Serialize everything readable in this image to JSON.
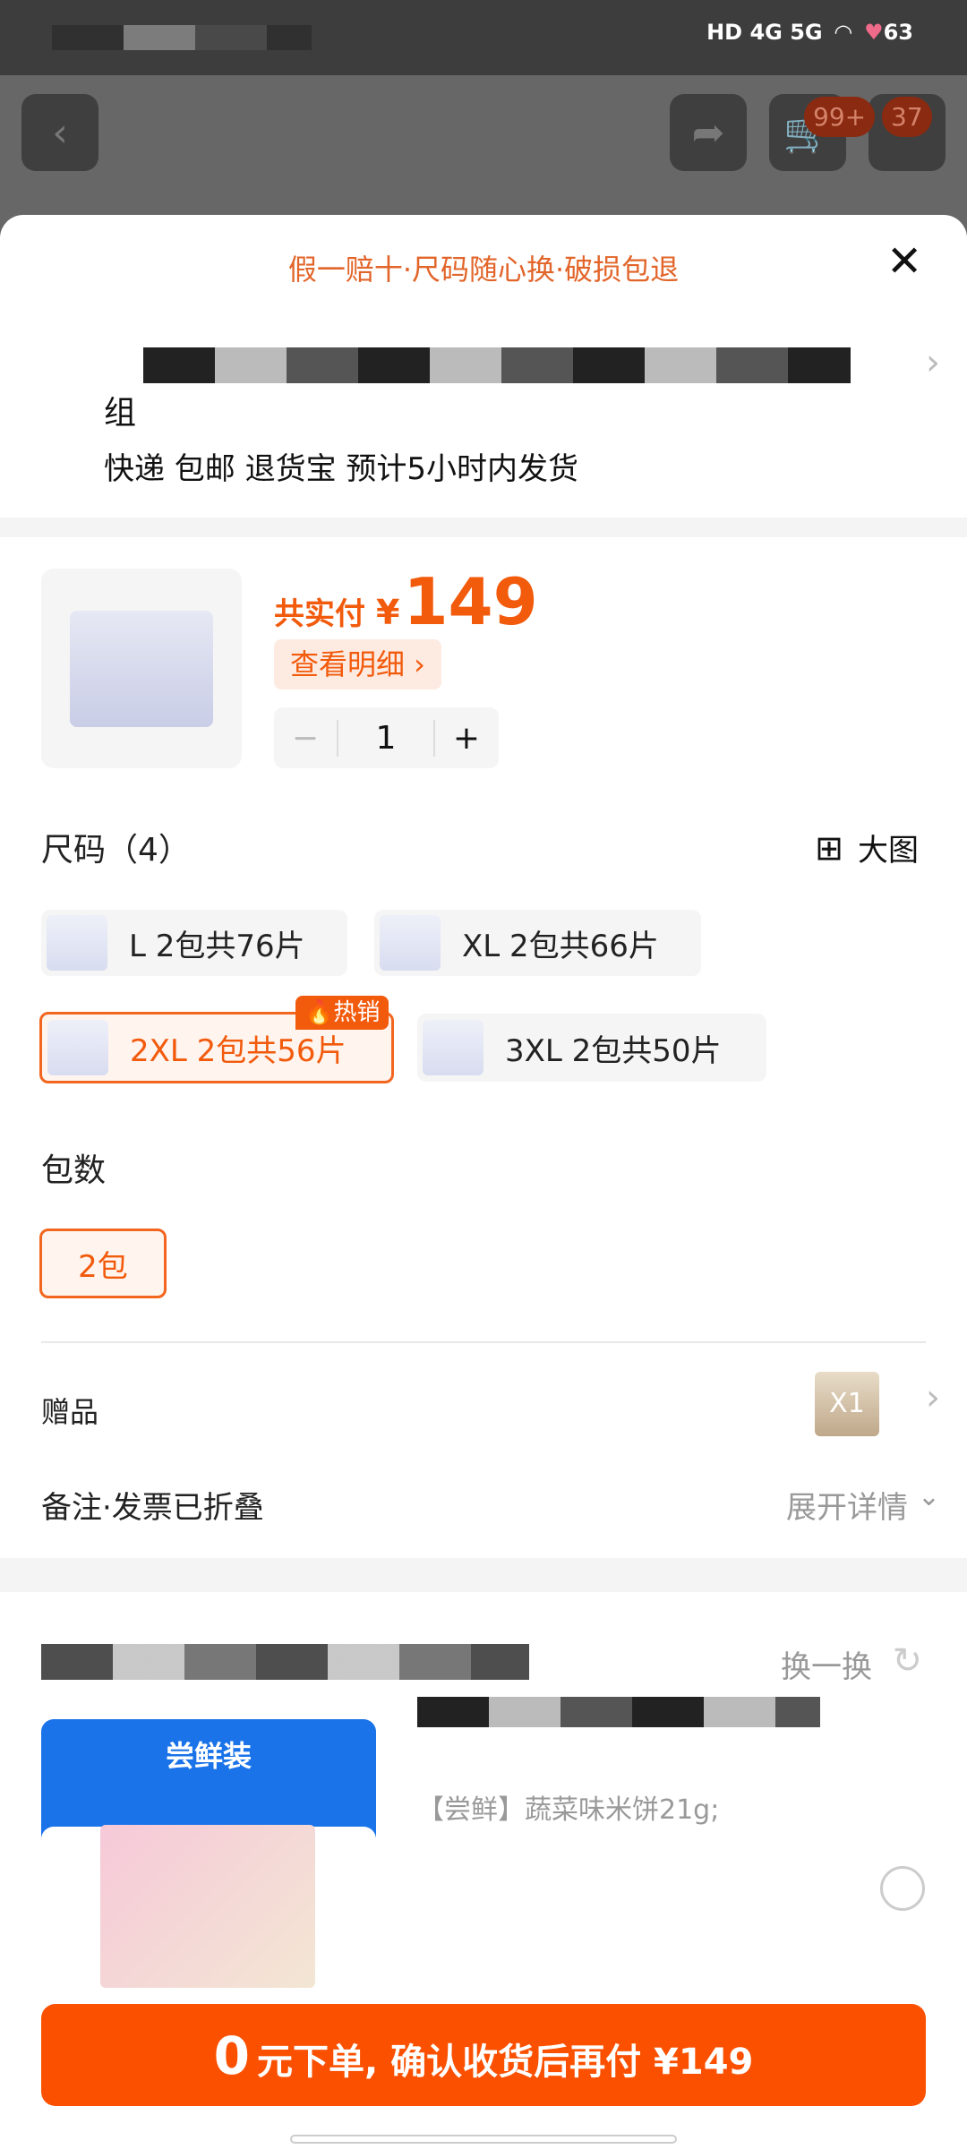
{
  "status_bar": {
    "network": "HD 4G 5G",
    "battery": "63"
  },
  "header": {
    "cart_badge": "99+",
    "message_badge": "37"
  },
  "sheet": {
    "guarantee": "假一赔十·尺码随心换·破损包退",
    "address_tail": "组",
    "shipping": "快递 包邮 退货宝 预计5小时内发货"
  },
  "product": {
    "total_label": "共实付",
    "currency": "¥",
    "price": "149",
    "detail_button": "查看明细 ›",
    "quantity": "1",
    "minus": "−",
    "plus": "+"
  },
  "size": {
    "title": "尺码（4）",
    "big_view": "大图",
    "options": [
      {
        "label": "L 2包共76片",
        "selected": false
      },
      {
        "label": "XL 2包共66片",
        "selected": false
      },
      {
        "label": "2XL 2包共56片",
        "selected": true,
        "badge": "热销"
      },
      {
        "label": "3XL 2包共50片",
        "selected": false
      }
    ]
  },
  "packs": {
    "title": "包数",
    "options": [
      {
        "label": "2包",
        "selected": true
      }
    ]
  },
  "gift": {
    "label": "赠品",
    "count": "X1"
  },
  "notes": {
    "label": "备注·发票已折叠",
    "expand": "展开详情"
  },
  "recommend": {
    "refresh": "换一换",
    "card_tag": "尝鲜装",
    "item_desc": "【尝鲜】蔬菜味米饼21g;"
  },
  "cta": {
    "amount": "0",
    "label": "元下单, 确认收货后再付 ¥149"
  },
  "colors": {
    "accent": "#f25a0c",
    "button": "#fa5000",
    "blue": "#1a73e8"
  }
}
